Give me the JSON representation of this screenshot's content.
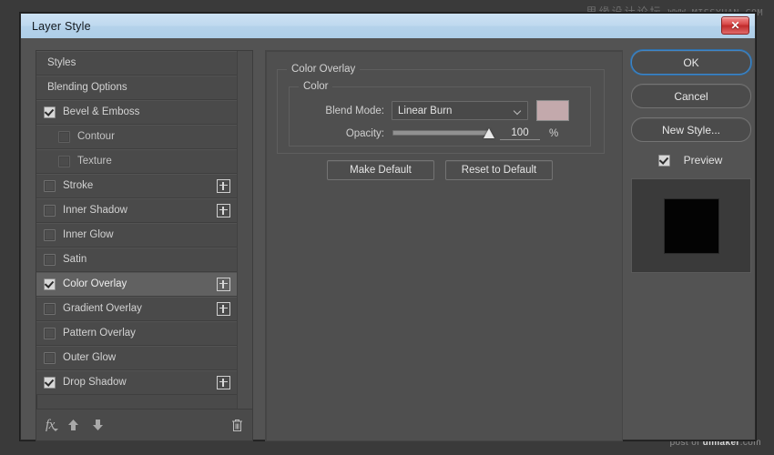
{
  "watermarks": {
    "top_cn": "思缘设计论坛",
    "top_url": "WWW.MISSYUAN.COM",
    "bottom_pre": "post of ",
    "bottom_brand": "uimaker",
    "bottom_post": ".com"
  },
  "window": {
    "title": "Layer Style",
    "close_label": "✕"
  },
  "styles_panel": {
    "items": [
      {
        "label": "Styles",
        "type": "header",
        "checkbox": "none",
        "plus": false,
        "selected": false
      },
      {
        "label": "Blending Options",
        "type": "header",
        "checkbox": "none",
        "plus": false,
        "selected": false
      },
      {
        "label": "Bevel & Emboss",
        "type": "top",
        "checkbox": "checked",
        "plus": false,
        "selected": false
      },
      {
        "label": "Contour",
        "type": "sub",
        "checkbox": "unchecked",
        "plus": false,
        "selected": false
      },
      {
        "label": "Texture",
        "type": "sub",
        "checkbox": "unchecked",
        "plus": false,
        "selected": false
      },
      {
        "label": "Stroke",
        "type": "top",
        "checkbox": "unchecked",
        "plus": true,
        "selected": false
      },
      {
        "label": "Inner Shadow",
        "type": "top",
        "checkbox": "unchecked",
        "plus": true,
        "selected": false
      },
      {
        "label": "Inner Glow",
        "type": "top",
        "checkbox": "unchecked",
        "plus": false,
        "selected": false
      },
      {
        "label": "Satin",
        "type": "top",
        "checkbox": "unchecked",
        "plus": false,
        "selected": false
      },
      {
        "label": "Color Overlay",
        "type": "top",
        "checkbox": "checked",
        "plus": true,
        "selected": true
      },
      {
        "label": "Gradient Overlay",
        "type": "top",
        "checkbox": "unchecked",
        "plus": true,
        "selected": false
      },
      {
        "label": "Pattern Overlay",
        "type": "top",
        "checkbox": "unchecked",
        "plus": false,
        "selected": false
      },
      {
        "label": "Outer Glow",
        "type": "top",
        "checkbox": "unchecked",
        "plus": false,
        "selected": false
      },
      {
        "label": "Drop Shadow",
        "type": "top",
        "checkbox": "checked",
        "plus": true,
        "selected": false
      }
    ],
    "toolbar": {
      "fx_icon": "fx-icon",
      "up_icon": "arrow-up-icon",
      "down_icon": "arrow-down-icon",
      "trash_icon": "trash-icon",
      "fx_glyph": "fx",
      "up_glyph": "⬆",
      "down_glyph": "⬇",
      "trash_glyph": "🗑"
    }
  },
  "options": {
    "group_title": "Color Overlay",
    "subgroup_title": "Color",
    "blend_mode_label": "Blend Mode:",
    "blend_mode_value": "Linear Burn",
    "color_swatch_hex": "#c3a9ac",
    "opacity_label": "Opacity:",
    "opacity_value": "100",
    "opacity_unit": "%",
    "opacity_percent": 100,
    "make_default_label": "Make Default",
    "reset_default_label": "Reset to Default"
  },
  "actions": {
    "ok_label": "OK",
    "cancel_label": "Cancel",
    "new_style_label": "New Style...",
    "preview_label": "Preview",
    "preview_checked": true
  }
}
